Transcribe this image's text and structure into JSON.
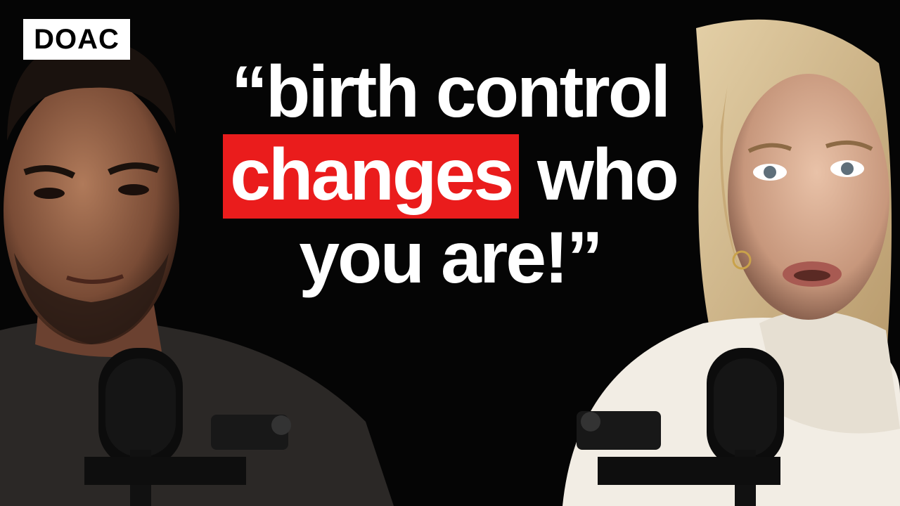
{
  "brand": {
    "logo_text": "DOAC",
    "accent_color": "#ea1c1c"
  },
  "headline": {
    "line1": "“birth control",
    "line2_highlight": "changes",
    "line2_rest": " who",
    "line3": "you are!”"
  },
  "people": [
    {
      "name": "left-host",
      "clothing": "dark t-shirt"
    },
    {
      "name": "right-guest",
      "clothing": "white turtleneck sweater"
    }
  ]
}
